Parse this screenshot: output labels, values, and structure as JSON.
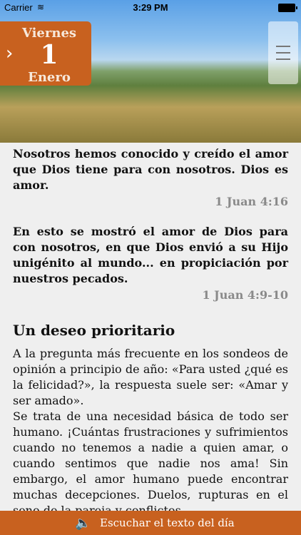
{
  "status_bar": {
    "carrier": "Carrier",
    "time": "3:29 PM"
  },
  "date": {
    "weekday": "Viernes",
    "day": "1",
    "month": "Enero"
  },
  "verses": [
    {
      "text": "Nosotros hemos conocido y creído el amor que Dios tiene para con nosotros. Dios es amor.",
      "reference": "1 Juan 4:16"
    },
    {
      "text": "En esto se mostró el amor de Dios para con nosotros, en que Dios envió a su Hijo unigénito al mundo... en propiciación por nuestros pecados.",
      "reference": "1 Juan 4:9-10"
    }
  ],
  "section_title": "Un deseo prioritario",
  "paragraphs": [
    "A la pregunta más frecuente en los sondeos de opinión a principio de año: «Para usted ¿qué es la felicidad?», la respuesta suele ser: «Amar y ser amado».",
    "Se trata de una necesidad básica de todo ser humano. ¡Cuántas frustraciones y sufrimientos cuando no tenemos a nadie a quien amar, o cuando sentimos que nadie nos ama! Sin embargo, el amor humano puede encontrar muchas decepciones. Duelos, rupturas en el seno de la pareja y conflictos"
  ],
  "bottom_bar": {
    "label": "Escuchar el texto del día"
  },
  "colors": {
    "accent": "#c8611f",
    "background": "#efefef",
    "reference": "#8a8a8a"
  },
  "icons": {
    "menu": "hamburger-icon",
    "next": "chevron-right-icon",
    "speaker": "speaker-icon",
    "wifi": "wifi-icon"
  }
}
